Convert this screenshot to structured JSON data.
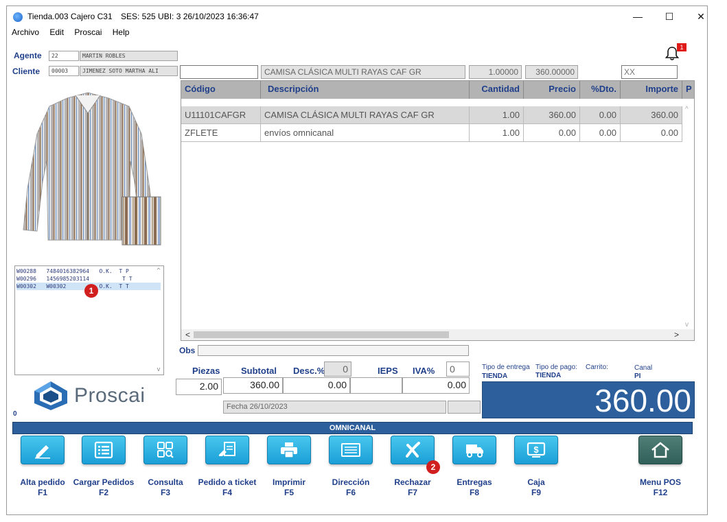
{
  "titlebar": {
    "title": "Tienda.003  Cajero C31",
    "session": "SES: 525  UBI: 3  26/10/2023 16:36:47",
    "minimize": "—",
    "maximize": "☐",
    "close": "✕"
  },
  "menu": [
    "Archivo",
    "Edit",
    "Proscai",
    "Help"
  ],
  "agent": {
    "label": "Agente",
    "code": "22",
    "name": "MARTIN ROBLES"
  },
  "client": {
    "label": "Cliente",
    "code": "00003",
    "name": "JIMENEZ SOTO MARTHA ALI"
  },
  "notification": {
    "count": "1",
    "icon": "bell-icon"
  },
  "item_entry": {
    "code": "",
    "description": "CAMISA CLÁSICA MULTI RAYAS CAF GR",
    "quantity": "1.00000",
    "price": "360.00000",
    "extra": "XX"
  },
  "grid": {
    "headers": [
      "Código",
      "Descripción",
      "Cantidad",
      "Precio",
      "%Dto.",
      "Importe",
      "P"
    ],
    "rows": [
      [
        "U11101CAFGR",
        "CAMISA CLÁSICA MULTI RAYAS CAF GR",
        "1.00",
        "360.00",
        "0.00",
        "360.00"
      ],
      [
        "ZFLETE",
        "envíos omnicanal",
        "1.00",
        "0.00",
        "0.00",
        "0.00"
      ]
    ]
  },
  "orders": [
    [
      "W00288",
      "7484016382964",
      "O.K.",
      "T P"
    ],
    [
      "W00296",
      "1456985203114",
      "",
      "T T"
    ],
    [
      "W00302",
      "W00302",
      "O.K.",
      "T T"
    ]
  ],
  "markers": {
    "one": "1",
    "two": "2"
  },
  "obs_label": "Obs",
  "totals": {
    "piezas_label": "Piezas",
    "piezas": "2.00",
    "subtotal_label": "Subtotal",
    "subtotal": "360.00",
    "desc_label": "Desc.%",
    "desc_pct": "0",
    "desc_val": "0.00",
    "ieps_label": "IEPS",
    "ieps": "",
    "iva_label": "IVA%",
    "iva_pct": "0",
    "iva_val": "0.00"
  },
  "fecha": "Fecha 26/10/2023",
  "delivery": {
    "tipo_entrega_label": "Tipo de entrega",
    "tipo_entrega": "TIENDA",
    "tipo_pago_label": "Tipo de pago:",
    "tipo_pago": "TIENDA",
    "carrito_label": "Carrito:",
    "canal_label": "Canal",
    "canal": "PI"
  },
  "total": "360.00",
  "logo_text": "Proscai",
  "left_zero": "0",
  "channel_bar": "OMNICANAL",
  "buttons": [
    {
      "name": "Alta pedido",
      "key": "F1",
      "icon": "pencil-icon"
    },
    {
      "name": "Cargar Pedidos",
      "key": "F2",
      "icon": "list-icon"
    },
    {
      "name": "Consulta",
      "key": "F3",
      "icon": "search-grid-icon"
    },
    {
      "name": "Pedido a ticket",
      "key": "F4",
      "icon": "ticket-icon"
    },
    {
      "name": "Imprimir",
      "key": "F5",
      "icon": "printer-icon"
    },
    {
      "name": "Dirección",
      "key": "F6",
      "icon": "address-card-icon"
    },
    {
      "name": "Rechazar",
      "key": "F7",
      "icon": "x-icon"
    },
    {
      "name": "Entregas",
      "key": "F8",
      "icon": "truck-icon"
    },
    {
      "name": "Caja",
      "key": "F9",
      "icon": "cash-icon"
    },
    {
      "name": "Menu POS",
      "key": "F12",
      "icon": "home-icon"
    }
  ]
}
